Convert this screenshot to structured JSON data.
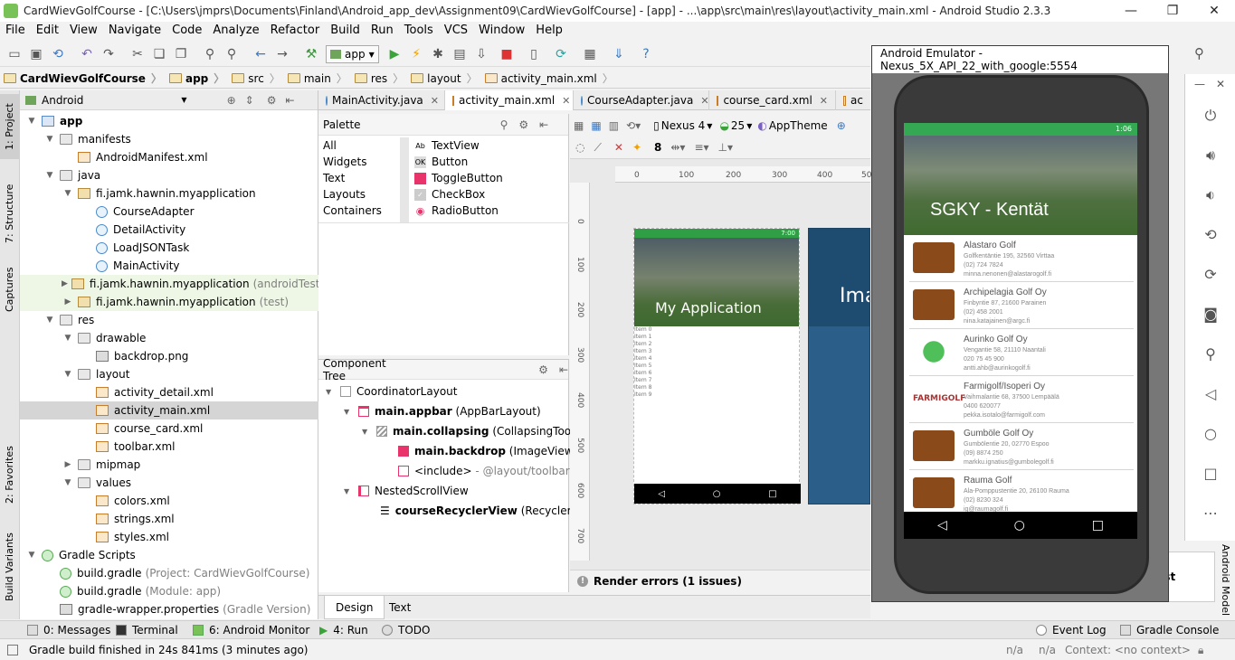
{
  "window": {
    "title": "CardWievGolfCourse - [C:\\Users\\jmprs\\Documents\\Finland\\Android_app_dev\\Assignment09\\CardWievGolfCourse] - [app] - ...\\app\\src\\main\\res\\layout\\activity_main.xml - Android Studio 2.3.3"
  },
  "menu": [
    "File",
    "Edit",
    "View",
    "Navigate",
    "Code",
    "Analyze",
    "Refactor",
    "Build",
    "Run",
    "Tools",
    "VCS",
    "Window",
    "Help"
  ],
  "toolbar": {
    "run_config": "app"
  },
  "breadcrumb": [
    "CardWievGolfCourse",
    "app",
    "src",
    "main",
    "res",
    "layout",
    "activity_main.xml"
  ],
  "side_tabs": {
    "project": "1: Project",
    "structure": "7: Structure",
    "captures": "Captures",
    "favorites": "2: Favorites",
    "build_variants": "Build Variants"
  },
  "project": {
    "view_mode": "Android",
    "tree": [
      {
        "label": "app",
        "bold": true,
        "icon": "module"
      },
      {
        "label": "manifests",
        "icon": "folder"
      },
      {
        "label": "AndroidManifest.xml",
        "icon": "xml"
      },
      {
        "label": "java",
        "icon": "folder"
      },
      {
        "label": "fi.jamk.hawnin.myapplication",
        "icon": "pkg"
      },
      {
        "label": "CourseAdapter",
        "icon": "cls"
      },
      {
        "label": "DetailActivity",
        "icon": "cls"
      },
      {
        "label": "LoadJSONTask",
        "icon": "cls"
      },
      {
        "label": "MainActivity",
        "icon": "cls"
      },
      {
        "label": "fi.jamk.hawnin.myapplication",
        "suffix": "(androidTest)",
        "icon": "pkg"
      },
      {
        "label": "fi.jamk.hawnin.myapplication",
        "suffix": "(test)",
        "icon": "pkg"
      },
      {
        "label": "res",
        "icon": "folder"
      },
      {
        "label": "drawable",
        "icon": "folder"
      },
      {
        "label": "backdrop.png",
        "icon": "img"
      },
      {
        "label": "layout",
        "icon": "folder"
      },
      {
        "label": "activity_detail.xml",
        "icon": "xml"
      },
      {
        "label": "activity_main.xml",
        "icon": "xml"
      },
      {
        "label": "course_card.xml",
        "icon": "xml"
      },
      {
        "label": "toolbar.xml",
        "icon": "xml"
      },
      {
        "label": "mipmap",
        "icon": "folder"
      },
      {
        "label": "values",
        "icon": "folder"
      },
      {
        "label": "colors.xml",
        "icon": "xml"
      },
      {
        "label": "strings.xml",
        "icon": "xml"
      },
      {
        "label": "styles.xml",
        "icon": "xml"
      },
      {
        "label": "Gradle Scripts",
        "icon": "gradle"
      },
      {
        "label": "build.gradle",
        "suffix": "(Project: CardWievGolfCourse)",
        "icon": "gradle"
      },
      {
        "label": "build.gradle",
        "suffix": "(Module: app)",
        "icon": "gradle"
      },
      {
        "label": "gradle-wrapper.properties",
        "suffix": "(Gradle Version)",
        "icon": "img"
      }
    ]
  },
  "editor_tabs": [
    "MainActivity.java",
    "activity_main.xml",
    "CourseAdapter.java",
    "course_card.xml",
    "ac"
  ],
  "palette": {
    "title": "Palette",
    "categories": [
      "All",
      "Widgets",
      "Text",
      "Layouts",
      "Containers"
    ],
    "items": [
      {
        "icon": "Ab",
        "label": "TextView"
      },
      {
        "icon": "OK",
        "label": "Button"
      },
      {
        "icon": "",
        "label": "ToggleButton"
      },
      {
        "icon": "✓",
        "label": "CheckBox"
      },
      {
        "icon": "◉",
        "label": "RadioButton"
      }
    ]
  },
  "component_tree": {
    "title": "Component Tree",
    "nodes": [
      {
        "id": "CoordinatorLayout",
        "type": ""
      },
      {
        "id": "main.appbar",
        "type": "(AppBarLayout)"
      },
      {
        "id": "main.collapsing",
        "type": "(CollapsingToolbarL"
      },
      {
        "id": "main.backdrop",
        "type": "(ImageView)"
      },
      {
        "id": "<include>",
        "type": "- @layout/toolbar"
      },
      {
        "id": "NestedScrollView",
        "type": ""
      },
      {
        "id": "courseRecyclerView",
        "type": "(RecyclerView"
      }
    ]
  },
  "design_toolbar": {
    "device": "Nexus 4",
    "api": "25",
    "theme": "AppTheme",
    "margin": "8"
  },
  "preview": {
    "title": "My Application",
    "time": "7:00",
    "items": [
      "Item 0",
      "Item 1",
      "Item 2",
      "Item 3",
      "Item 4",
      "Item 5",
      "Item 6",
      "Item 7",
      "Item 8",
      "Item 9"
    ],
    "blueprint_title": "Ima"
  },
  "ruler_h": [
    "0",
    "100",
    "200",
    "300",
    "400",
    "50"
  ],
  "ruler_v": [
    "0",
    "100",
    "200",
    "300",
    "400",
    "500",
    "600",
    "700"
  ],
  "render_errors": "Render errors (1 issues)",
  "bottom_tabs": [
    "Design",
    "Text"
  ],
  "tool_windows": [
    "0: Messages",
    "Terminal",
    "6: Android Monitor",
    "4: Run",
    "TODO",
    "Event Log",
    "Gradle Console"
  ],
  "status": {
    "message": "Gradle build finished in 24s 841ms (3 minutes ago)",
    "na1": "n/a",
    "na2": "n/a",
    "context": "Context: <no context>"
  },
  "emulator": {
    "title": "Android Emulator - Nexus_5X_API_22_with_google:5554",
    "time": "1:06",
    "hero_title": "SGKY - Kentät",
    "courses": [
      {
        "name": "Alastaro Golf",
        "address": "Golfkentäntie 195, 32560 Virttaa",
        "phone": "(02) 724 7824",
        "email": "minna.nenonen@alastarogolf.fi",
        "logo": "card"
      },
      {
        "name": "Archipelagia Golf Oy",
        "address": "Finbyntie 87, 21600 Parainen",
        "phone": "(02) 458 2001",
        "email": "nina.katajainen@argc.fi",
        "logo": "card"
      },
      {
        "name": "Aurinko Golf Oy",
        "address": "Vengantie 58, 21110 Naantali",
        "phone": "020 75 45 900",
        "email": "antti.ahb@aurinkogolf.fi",
        "logo": "green"
      },
      {
        "name": "Farmigolf/Isoperi Oy",
        "address": "Vaihmalantie 68, 37500 Lempäälä",
        "phone": "0400 620077",
        "email": "pekka.isotalo@farmigolf.com",
        "logo": "FARMIGOLF"
      },
      {
        "name": "Gumböle Golf Oy",
        "address": "Gumbölentie 20, 02770 Espoo",
        "phone": "(09) 8874 250",
        "email": "markku.ignatius@gumbolegolf.fi",
        "logo": "card"
      },
      {
        "name": "Rauma Golf",
        "address": "Ala-Pomppustentie 20, 26100 Rauma",
        "phone": "(02) 8230 324",
        "email": "ig@raumagolf.fi",
        "logo": "card"
      }
    ]
  },
  "right_tabs": {
    "android_model": "Android Model"
  },
  "popup_partial": "e st"
}
